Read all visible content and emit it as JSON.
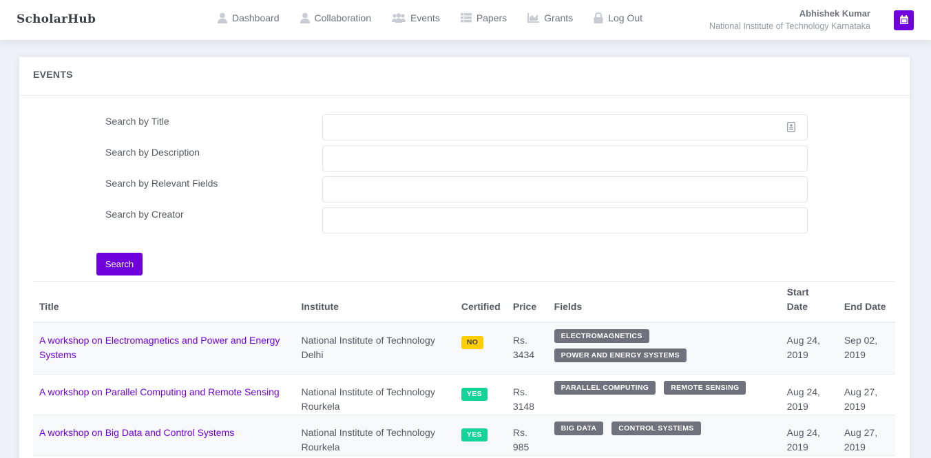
{
  "app": {
    "brand": "ScholarHub"
  },
  "nav": [
    {
      "label": "Dashboard",
      "icon": "user-icon"
    },
    {
      "label": "Collaboration",
      "icon": "user-icon"
    },
    {
      "label": "Events",
      "icon": "users-icon"
    },
    {
      "label": "Papers",
      "icon": "list-icon"
    },
    {
      "label": "Grants",
      "icon": "chart-icon"
    },
    {
      "label": "Log Out",
      "icon": "lock-icon"
    }
  ],
  "user": {
    "name": "Abhishek Kumar",
    "institute": "National Institute of Technology Karnataka"
  },
  "colors": {
    "accent": "#6f00dc",
    "badge_no": "#ffcd00",
    "badge_yes": "#16d39a",
    "chip": "#6f727d"
  },
  "page": {
    "title": "EVENTS"
  },
  "search": {
    "title_label": "Search by Title",
    "title_value": "",
    "description_label": "Search by Description",
    "description_value": "",
    "fields_label": "Search by Relevant Fields",
    "fields_value": "",
    "creator_label": "Search by Creator",
    "creator_value": "",
    "button": "Search"
  },
  "table": {
    "headers": {
      "title": "Title",
      "institute": "Institute",
      "certified": "Certified",
      "price": "Price",
      "fields": "Fields",
      "start_line1": "Start",
      "start_line2": "Date",
      "end": "End Date"
    },
    "rows": [
      {
        "title": "A workshop on Electromagnetics and Power and Energy Systems",
        "institute": "National Institute of Technology Delhi",
        "certified": "NO",
        "price": "Rs. 3434",
        "fields": [
          "ELECTROMAGNETICS",
          "POWER AND ENERGY SYSTEMS"
        ],
        "start": "Aug 24, 2019",
        "end": "Sep 02, 2019"
      },
      {
        "title": "A workshop on Parallel Computing and Remote Sensing",
        "institute": "National Institute of Technology Rourkela",
        "certified": "YES",
        "price": "Rs. 3148",
        "fields": [
          "PARALLEL COMPUTING",
          "REMOTE SENSING"
        ],
        "start": "Aug 24, 2019",
        "end": "Aug 27, 2019"
      },
      {
        "title": "A workshop on Big Data and Control Systems",
        "institute": "National Institute of Technology Rourkela",
        "certified": "YES",
        "price": "Rs. 985",
        "fields": [
          "BIG DATA",
          "CONTROL SYSTEMS"
        ],
        "start": "Aug 24, 2019",
        "end": "Aug 27, 2019"
      }
    ]
  }
}
